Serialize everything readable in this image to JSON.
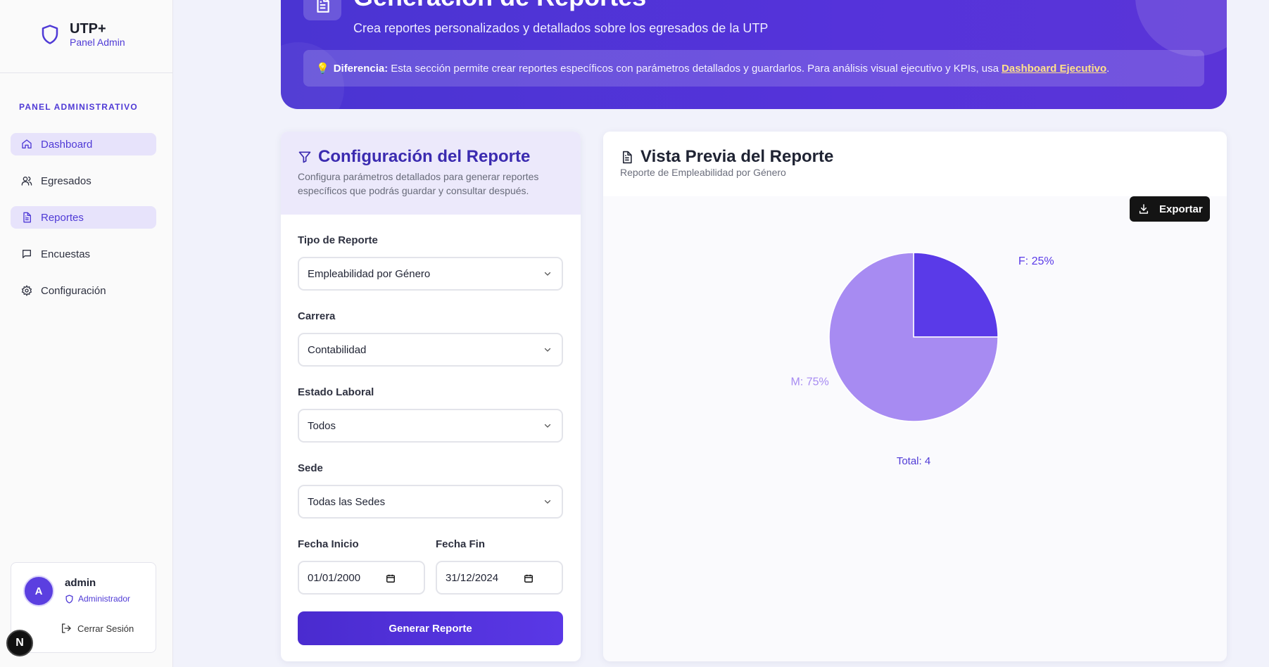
{
  "brand": {
    "title": "UTP+",
    "subtitle": "Panel Admin"
  },
  "sidebar": {
    "section_label": "PANEL ADMINISTRATIVO",
    "items": [
      {
        "label": "Dashboard",
        "icon": "home-icon",
        "active": true
      },
      {
        "label": "Egresados",
        "icon": "users-icon",
        "active": false
      },
      {
        "label": "Reportes",
        "icon": "file-text-icon",
        "active": true
      },
      {
        "label": "Encuestas",
        "icon": "message-square-icon",
        "active": false
      },
      {
        "label": "Configuración",
        "icon": "gear-icon",
        "active": false
      }
    ]
  },
  "user": {
    "initial": "A",
    "name": "admin",
    "role": "Administrador",
    "logout_label": "Cerrar Sesión"
  },
  "dev_badge": "N",
  "header": {
    "title": "Generación de Reportes",
    "subtitle": "Crea reportes personalizados y detallados sobre los egresados de la UTP",
    "note_prefix": "Diferencia:",
    "note_text": "Esta sección permite crear reportes específicos con parámetros detallados y guardarlos. Para análisis visual ejecutivo y KPIs, usa",
    "note_link": "Dashboard Ejecutivo",
    "note_suffix": ".",
    "note_icon": "lightbulb-icon"
  },
  "config": {
    "title": "Configuración del Reporte",
    "description": "Configura parámetros detallados para generar reportes específicos que podrás guardar y consultar después.",
    "tipo_label": "Tipo de Reporte",
    "tipo_value": "Empleabilidad por Género",
    "carrera_label": "Carrera",
    "carrera_value": "Contabilidad",
    "estado_label": "Estado Laboral",
    "estado_value": "Todos",
    "sede_label": "Sede",
    "sede_value": "Todas las Sedes",
    "fecha_inicio_label": "Fecha Inicio",
    "fecha_inicio_value": "01/01/2000",
    "fecha_fin_label": "Fecha Fin",
    "fecha_fin_value": "31/12/2024",
    "generate_label": "Generar Reporte"
  },
  "preview": {
    "title": "Vista Previa del Reporte",
    "subtitle": "Reporte de Empleabilidad por Género",
    "export_label": "Exportar"
  },
  "chart_data": {
    "type": "pie",
    "categories": [
      "F",
      "M"
    ],
    "values": [
      25,
      75
    ],
    "slice_labels": [
      "F: 25%",
      "M: 75%"
    ],
    "colors": [
      "#5a3ae8",
      "#a78bf2"
    ],
    "total_label": "Total: 4"
  },
  "colors": {
    "accent": "#4f3ad6",
    "banner": "#5533da",
    "active_bg": "#e7e3fb"
  }
}
